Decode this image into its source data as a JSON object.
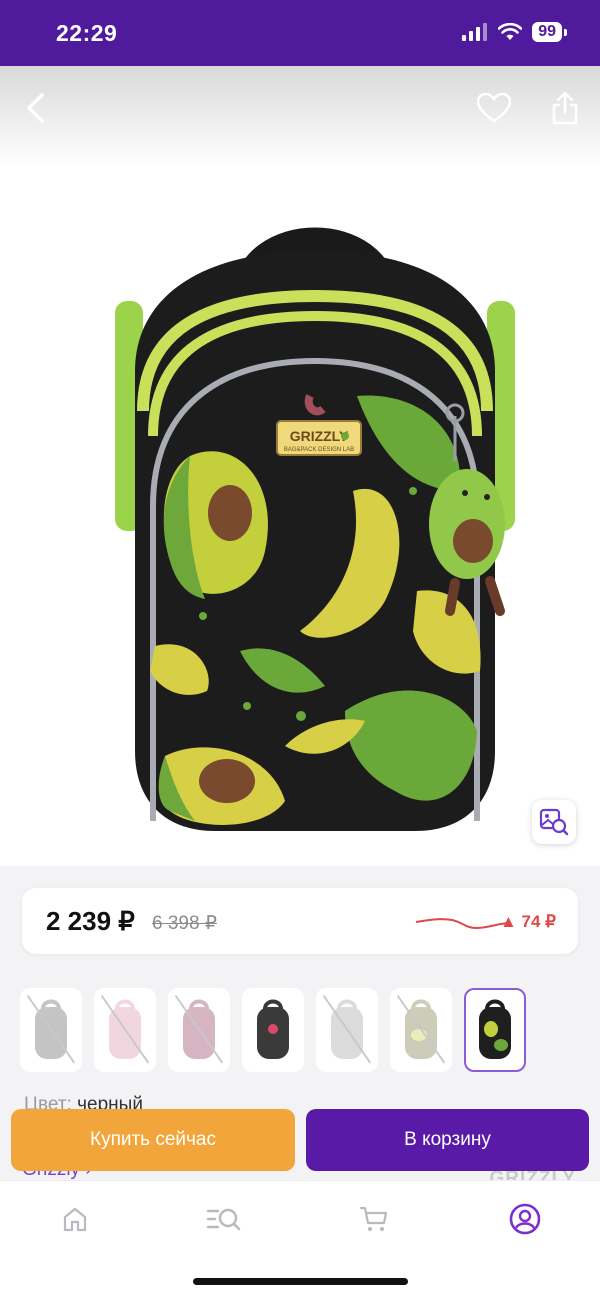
{
  "status_bar": {
    "time": "22:29",
    "battery": "99"
  },
  "product": {
    "price_current": "2 239 ₽",
    "price_old": "6 398 ₽",
    "price_delta": "▲ 74 ₽",
    "logo_text": "GRIZZLY",
    "logo_subtext": "BAG&PACK DESIGN LAB",
    "color_label": "Цвет:",
    "color_value": "черный",
    "brand_link": "Grizzly ›",
    "brand_logo": "GRIZZLY"
  },
  "thumbnails": [
    {
      "color": "#5a5a5a",
      "available": false
    },
    {
      "color": "#d98aa6",
      "available": false
    },
    {
      "color": "#8e2b4f",
      "available": false
    },
    {
      "color": "#3a3a3a",
      "available": true
    },
    {
      "color": "#9a9a9a",
      "available": false
    },
    {
      "color": "#6f6f3a",
      "available": false
    },
    {
      "color": "#1f1f1f",
      "available": true,
      "selected": true
    }
  ],
  "actions": {
    "buy_now": "Купить сейчас",
    "add_to_cart": "В корзину"
  },
  "tabbar": {
    "items": [
      "home-icon",
      "catalog-search-icon",
      "cart-icon",
      "profile-icon"
    ],
    "active_color": "#7b2fd0"
  },
  "colors": {
    "brand": "#4f1a9c",
    "buy": "#f2a53a",
    "cart": "#5a1aa8"
  }
}
